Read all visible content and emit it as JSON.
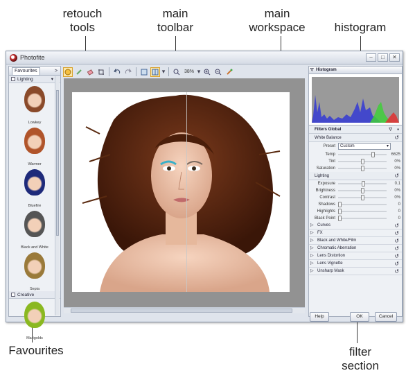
{
  "callouts": {
    "retouch_tools": "retouch\ntools",
    "main_toolbar": "main\ntoolbar",
    "main_workspace": "main\nworkspace",
    "histogram": "histogram",
    "favourites": "Favourites",
    "filter_section": "filter\nsection"
  },
  "window": {
    "title": "Photofite",
    "btn_min": "–",
    "btn_max": "□",
    "btn_close": "✕"
  },
  "toolbar": {
    "zoom": "38%"
  },
  "favourites": {
    "tab_label": "Favourites",
    "tab_arrow": ">",
    "categories": [
      "Lighting",
      "Creative"
    ],
    "items": [
      {
        "label": "Lowkey",
        "tone": "#8a4a2a"
      },
      {
        "label": "Warmer",
        "tone": "#b0542a"
      },
      {
        "label": "Bluefire",
        "tone": "#1e2a7a"
      },
      {
        "label": "Black and White",
        "tone": "#555555"
      },
      {
        "label": "Sepia",
        "tone": "#9a7a3a"
      },
      {
        "label": "Marigolds",
        "tone": "#8ab820"
      }
    ]
  },
  "filter": {
    "histogram_title": "Histogram",
    "global_title": "Filters Global",
    "white_balance": {
      "title": "White Balance",
      "preset_label": "Preset",
      "preset_value": "Custom",
      "sliders": [
        {
          "name": "Temp",
          "value": "6625",
          "pos": 0.72
        },
        {
          "name": "Tint",
          "value": "0%",
          "pos": 0.5
        },
        {
          "name": "Saturation",
          "value": "0%",
          "pos": 0.5
        }
      ]
    },
    "lighting": {
      "title": "Lighting",
      "sliders": [
        {
          "name": "Exposure",
          "value": "0.1",
          "pos": 0.52
        },
        {
          "name": "Brightness",
          "value": "0%",
          "pos": 0.5
        },
        {
          "name": "Contrast",
          "value": "0%",
          "pos": 0.5
        },
        {
          "name": "Shadows",
          "value": "0",
          "pos": 0.0
        },
        {
          "name": "Highlights",
          "value": "0",
          "pos": 0.0
        },
        {
          "name": "Black Point",
          "value": "0",
          "pos": 0.0
        }
      ]
    },
    "collapsed": [
      "Curves",
      "FX",
      "Black and White/Film",
      "Chromatic Aberration",
      "Lens Distortion",
      "Lens Vignette",
      "Unsharp Mask"
    ],
    "buttons": {
      "help": "Help",
      "ok": "OK",
      "cancel": "Cancel"
    }
  },
  "colors": {
    "accent": "#d9a12a",
    "histogram_blue": "#3a3fd0",
    "histogram_green": "#3fcf3a",
    "histogram_red": "#e03030"
  }
}
